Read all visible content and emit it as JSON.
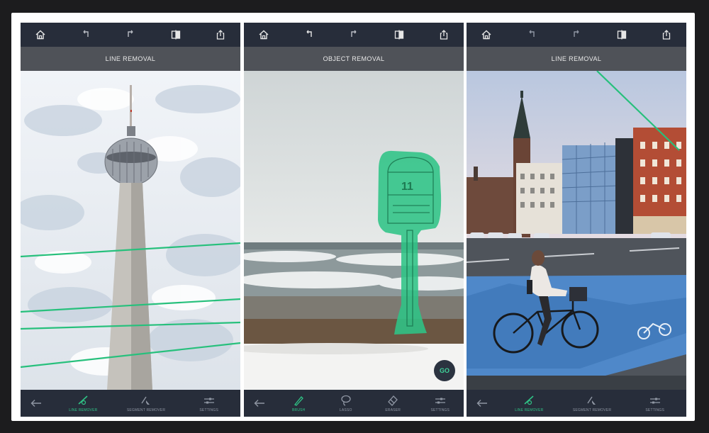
{
  "screens": [
    {
      "title": "LINE REMOVAL",
      "tools": [
        {
          "label": "LINE REMOVER",
          "icon": "line-remover-icon",
          "active": true
        },
        {
          "label": "SEGMENT REMOVER",
          "icon": "segment-remover-icon",
          "active": false
        },
        {
          "label": "SETTINGS",
          "icon": "settings-sliders-icon",
          "active": false
        }
      ]
    },
    {
      "title": "OBJECT REMOVAL",
      "go_label": "GO",
      "tools": [
        {
          "label": "BRUSH",
          "icon": "brush-icon",
          "active": true
        },
        {
          "label": "LASSO",
          "icon": "lasso-icon",
          "active": false
        },
        {
          "label": "ERASER",
          "icon": "eraser-icon",
          "active": false
        },
        {
          "label": "SETTINGS",
          "icon": "settings-sliders-icon",
          "active": false
        }
      ]
    },
    {
      "title": "LINE REMOVAL",
      "tools": [
        {
          "label": "LINE REMOVER",
          "icon": "line-remover-icon",
          "active": true
        },
        {
          "label": "SEGMENT REMOVER",
          "icon": "segment-remover-icon",
          "active": false
        },
        {
          "label": "SETTINGS",
          "icon": "settings-sliders-icon",
          "active": false
        }
      ]
    }
  ],
  "toolbar_icons": [
    "home-icon",
    "undo-icon",
    "redo-icon",
    "compare-icon",
    "share-icon"
  ],
  "colors": {
    "accent": "#2fc486",
    "toolbar_bg": "#272d3a",
    "title_bg": "#4f5258"
  }
}
